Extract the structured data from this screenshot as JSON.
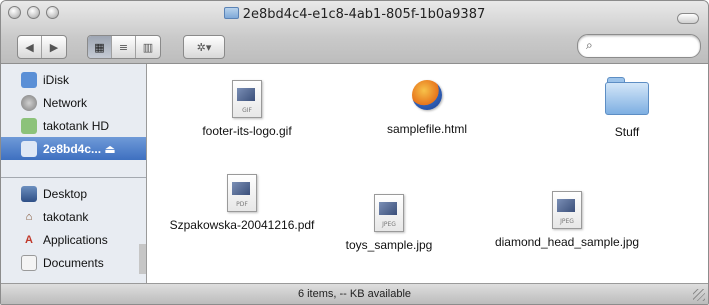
{
  "window": {
    "title": "2e8bd4c4-e1c8-4ab1-805f-1b0a9387",
    "status": "6 items, -- KB available"
  },
  "toolbar": {
    "back_icon": "back-arrow-icon",
    "forward_icon": "forward-arrow-icon",
    "view_icon_label": "▦",
    "view_list_label": "≡",
    "view_column_label": "▥",
    "action_label": "✲▾",
    "search_placeholder": ""
  },
  "sidebar": {
    "items": [
      {
        "label": "iDisk",
        "icon": "idisk-icon"
      },
      {
        "label": "Network",
        "icon": "network-icon"
      },
      {
        "label": "takotank HD",
        "icon": "harddrive-icon"
      },
      {
        "label": "2e8bd4c... ⏏",
        "icon": "disk-image-icon",
        "selected": true
      },
      {
        "label": "Desktop",
        "icon": "desktop-icon"
      },
      {
        "label": "takotank",
        "icon": "home-icon"
      },
      {
        "label": "Applications",
        "icon": "applications-icon"
      },
      {
        "label": "Documents",
        "icon": "documents-icon"
      }
    ]
  },
  "files": [
    {
      "name": "footer-its-logo.gif",
      "type": "GIF"
    },
    {
      "name": "samplefile.html",
      "type": "html"
    },
    {
      "name": "Stuff",
      "type": "folder"
    },
    {
      "name": "Szpakowska-20041216.pdf",
      "type": "PDF"
    },
    {
      "name": "toys_sample.jpg",
      "type": "JPEG"
    },
    {
      "name": "diamond_head_sample.jpg",
      "type": "JPEG"
    }
  ],
  "colors": {
    "selection": "#3e70c0",
    "sidebar_bg": "#e8ecf2"
  }
}
